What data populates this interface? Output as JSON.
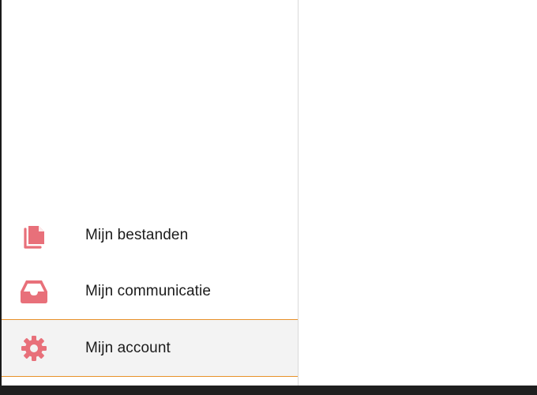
{
  "menu": {
    "items": [
      {
        "label": "Mijn bestanden",
        "icon": "files-icon"
      },
      {
        "label": "Mijn communicatie",
        "icon": "inbox-icon"
      },
      {
        "label": "Mijn account",
        "icon": "gear-icon"
      }
    ],
    "active_index": 2
  },
  "colors": {
    "icon": "#e8707a",
    "active_border": "#e8912a",
    "active_background": "#f3f3f3"
  }
}
